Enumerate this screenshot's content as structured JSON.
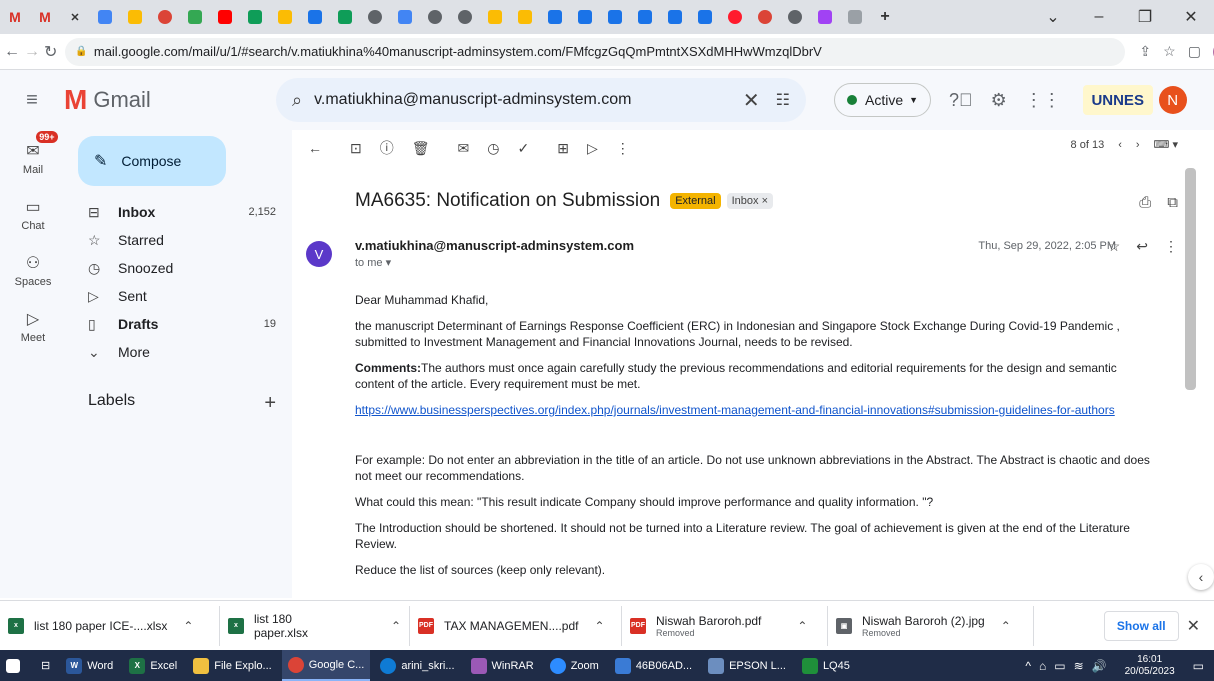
{
  "browser": {
    "url": "mail.google.com/mail/u/1/#search/v.matiukhina%40manuscript-adminsystem.com/FMfcgzGqQmPmtntXSXdMHHwWmzqlDbrV",
    "profile_initial": "N"
  },
  "gmail": {
    "logo_text": "Gmail",
    "search_value": "v.matiukhina@manuscript-adminsystem.com",
    "status": "Active",
    "org_badge": "UNNES",
    "avatar_initial": "N"
  },
  "rail": {
    "mail_badge": "99+",
    "items": [
      "Mail",
      "Chat",
      "Spaces",
      "Meet"
    ]
  },
  "sidebar": {
    "compose": "Compose",
    "folders": [
      {
        "label": "Inbox",
        "count": "2,152"
      },
      {
        "label": "Starred",
        "count": ""
      },
      {
        "label": "Snoozed",
        "count": ""
      },
      {
        "label": "Sent",
        "count": ""
      },
      {
        "label": "Drafts",
        "count": "19"
      },
      {
        "label": "More",
        "count": ""
      }
    ],
    "labels_heading": "Labels"
  },
  "message": {
    "pager": "8 of 13",
    "subject": "MA6635: Notification on Submission",
    "tag_external": "External",
    "tag_inbox": "Inbox",
    "sender_initial": "V",
    "sender": "v.matiukhina@manuscript-adminsystem.com",
    "to": "to me",
    "date": "Thu, Sep 29, 2022, 2:05 PM",
    "greeting": "Dear Muhammad Khafid,",
    "p1": "the manuscript Determinant of Earnings Response Coefficient (ERC) in Indonesian and Singapore Stock Exchange During Covid-19 Pandemic , submitted to Investment Management and Financial Innovations Journal, needs to be revised.",
    "p2_label": "Comments:",
    "p2": "The authors must once again carefully study the previous recommendations and editorial requirements for the design and semantic content of the article. Every requirement must be met.",
    "link": "https://www.businessperspectives.org/index.php/journals/investment-management-and-financial-innovations#submission-guidelines-for-authors",
    "p3": "For example: Do not enter an abbreviation in the title of an article. Do not use unknown abbreviations in the Abstract. The Abstract is chaotic and does not meet our recommendations.",
    "p4": "What could this mean: \"This result indicate Company should improve performance and quality information. \"?",
    "p5": "The Introduction should be shortened. It should not be turned into a Literature review. The goal of achievement is given at the end of the Literature Review.",
    "p6": "Reduce the list of sources (keep only relevant)."
  },
  "downloads": {
    "items": [
      {
        "name": "list 180 paper ICE-....xlsx",
        "sub": "",
        "color": "#1e7145",
        "icon": "x"
      },
      {
        "name": "list 180 paper.xlsx",
        "sub": "",
        "color": "#1e7145",
        "icon": "x"
      },
      {
        "name": "TAX MANAGEMEN....pdf",
        "sub": "",
        "color": "#d93025",
        "icon": "PDF"
      },
      {
        "name": "Niswah Baroroh.pdf",
        "sub": "Removed",
        "color": "#d93025",
        "icon": "PDF"
      },
      {
        "name": "Niswah Baroroh (2).jpg",
        "sub": "Removed",
        "color": "#5f6368",
        "icon": "img"
      }
    ],
    "show_all": "Show all"
  },
  "taskbar": {
    "items": [
      "Word",
      "Excel",
      "File Explo...",
      "Google C...",
      "arini_skri...",
      "WinRAR",
      "Zoom",
      "46B06AD...",
      "EPSON L...",
      "LQ45"
    ],
    "time": "16:01",
    "date": "20/05/2023"
  }
}
